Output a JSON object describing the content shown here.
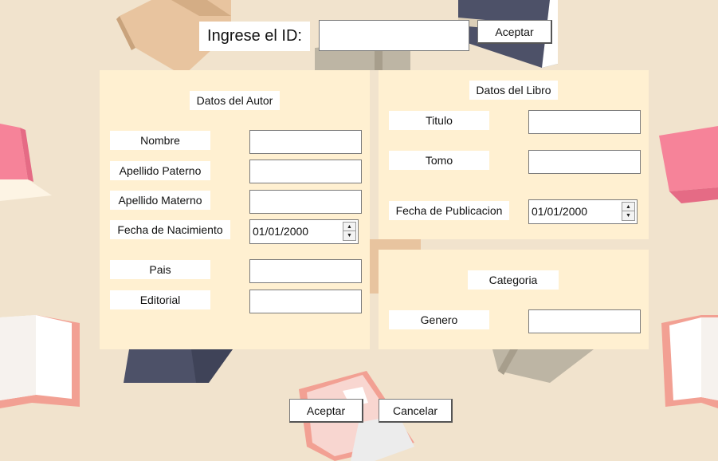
{
  "header": {
    "id_label": "Ingrese el ID:",
    "id_value": "",
    "accept_label": "Aceptar"
  },
  "author": {
    "title": "Datos del Autor",
    "fields": [
      {
        "label": "Nombre",
        "value": ""
      },
      {
        "label": "Apellido Paterno",
        "value": ""
      },
      {
        "label": "Apellido Materno",
        "value": ""
      },
      {
        "label": "Fecha de Nacimiento",
        "value": "01/01/2000"
      },
      {
        "label": "Pais",
        "value": ""
      },
      {
        "label": "Editorial",
        "value": ""
      }
    ]
  },
  "book": {
    "title": "Datos del Libro",
    "fields": [
      {
        "label": "Titulo",
        "value": ""
      },
      {
        "label": "Tomo",
        "value": ""
      },
      {
        "label": "Fecha de Publicacion",
        "value": "01/01/2000"
      }
    ]
  },
  "category": {
    "title": "Categoria",
    "genre_label": "Genero",
    "genre_value": ""
  },
  "footer": {
    "accept_label": "Aceptar",
    "cancel_label": "Cancelar"
  },
  "colors": {
    "background": "#f1e3cd",
    "panel": "#fff0d1",
    "book_pink": "#f47b94",
    "book_navy": "#4a4f65",
    "book_tan": "#e6c09a",
    "book_grey": "#bdb3a2"
  }
}
